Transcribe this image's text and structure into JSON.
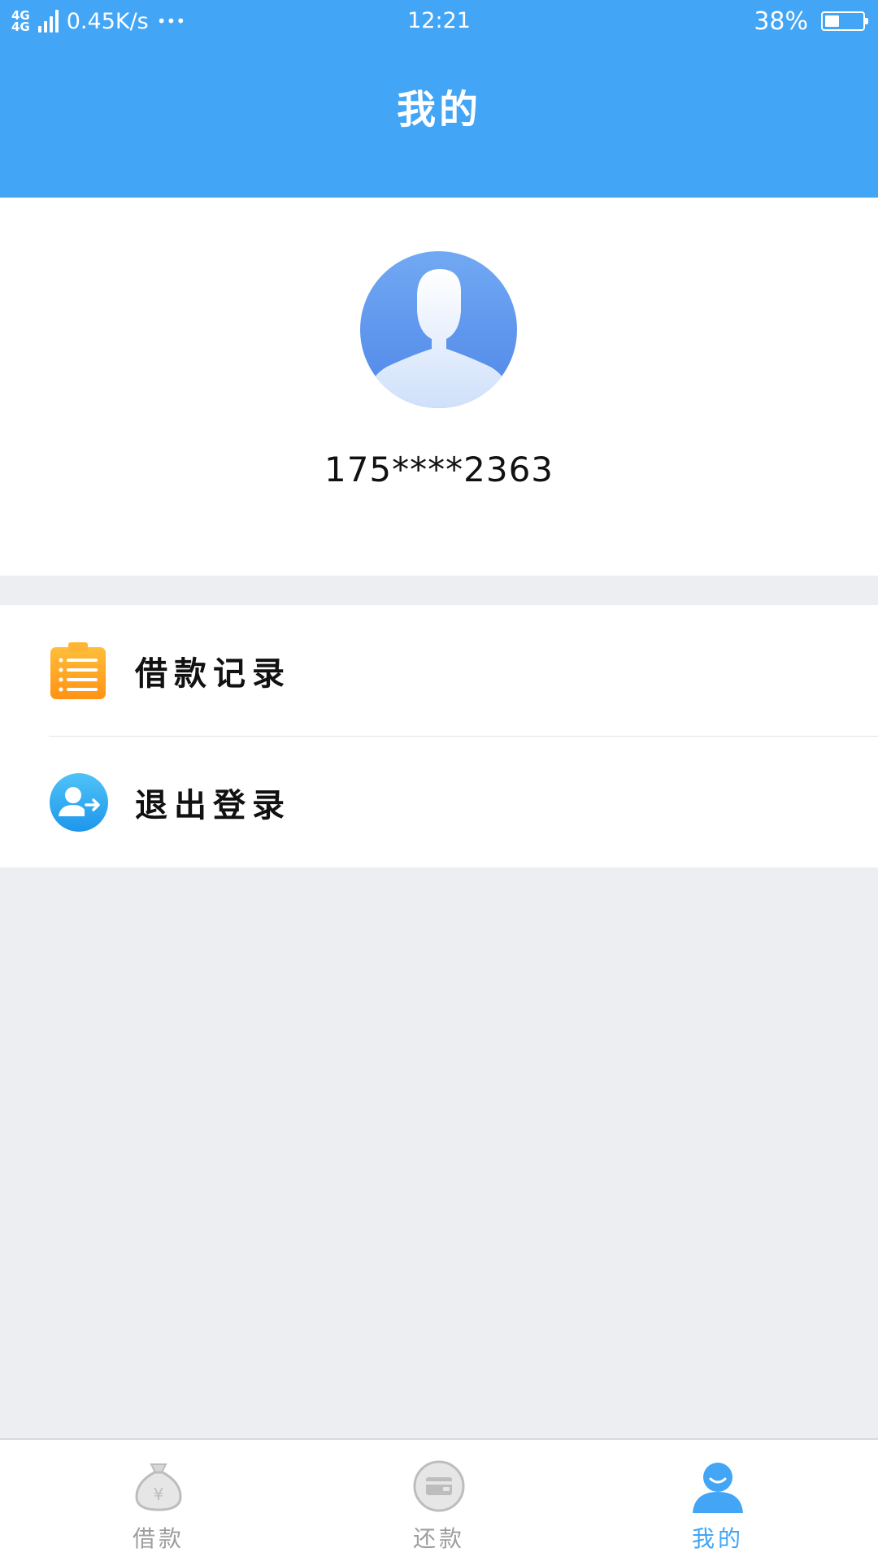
{
  "status_bar": {
    "network": "4G",
    "speed": "0.45K/s",
    "more": "•••",
    "time": "12:21",
    "battery_percent": "38%",
    "battery_level": 0.38
  },
  "header": {
    "title": "我的"
  },
  "profile": {
    "phone": "175****2363",
    "avatar_icon": "user-avatar-icon"
  },
  "menu": {
    "items": [
      {
        "label": "借款记录",
        "icon": "clipboard-list-icon",
        "color": "#FFA21F"
      },
      {
        "label": "退出登录",
        "icon": "user-logout-icon",
        "color": "#2BA6F0"
      }
    ]
  },
  "bottom_nav": {
    "tabs": [
      {
        "label": "借款",
        "icon": "money-bag-icon",
        "active": false
      },
      {
        "label": "还款",
        "icon": "wallet-icon",
        "active": false
      },
      {
        "label": "我的",
        "icon": "person-icon",
        "active": true
      }
    ],
    "active_color": "#42A5F6",
    "inactive_color": "#BDBDBD"
  },
  "colors": {
    "primary": "#42A5F6",
    "background": "#ECEEF2"
  }
}
